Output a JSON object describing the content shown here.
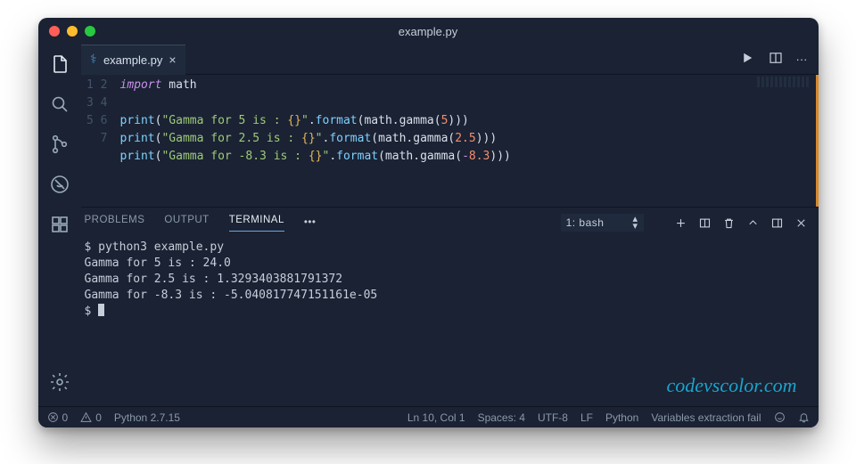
{
  "titlebar": {
    "title": "example.py"
  },
  "tab": {
    "filename": "example.py",
    "close_glyph": "×"
  },
  "editor_actions": {
    "more_glyph": "···"
  },
  "editor": {
    "line_numbers": [
      "1",
      "2",
      "3",
      "4",
      "5",
      "6",
      "7"
    ],
    "l1": {
      "kw": "import",
      "mod": " math"
    },
    "print_fn": "print",
    "format_fn": "format",
    "gamma_path": "math.gamma",
    "l3": {
      "str_a": "\"Gamma for 5 is : ",
      "brace": "{}",
      "str_b": "\"",
      "arg": "5"
    },
    "l4": {
      "str_a": "\"Gamma for 2.5 is : ",
      "brace": "{}",
      "str_b": "\"",
      "arg": "2.5"
    },
    "l5": {
      "str_a": "\"Gamma for -8.3 is : ",
      "brace": "{}",
      "str_b": "\"",
      "op": "-",
      "arg": "8.3"
    }
  },
  "panel": {
    "tabs": {
      "problems": "PROBLEMS",
      "output": "OUTPUT",
      "terminal": "TERMINAL"
    },
    "more_glyph": "•••",
    "select_label": "1: bash"
  },
  "terminal": {
    "prompt": "$ ",
    "cmd": "python3 example.py",
    "out1": "Gamma for 5 is : 24.0",
    "out2": "Gamma for 2.5 is : 1.3293403881791372",
    "out3": "Gamma for -8.3 is : -5.040817747151161e-05"
  },
  "status": {
    "errors": "0",
    "warnings": "0",
    "python_version": "Python 2.7.15",
    "position": "Ln 10, Col 1",
    "spaces": "Spaces: 4",
    "encoding": "UTF-8",
    "eol": "LF",
    "language": "Python",
    "right_message": "Variables extraction fail"
  },
  "watermark": "codevscolor.com"
}
